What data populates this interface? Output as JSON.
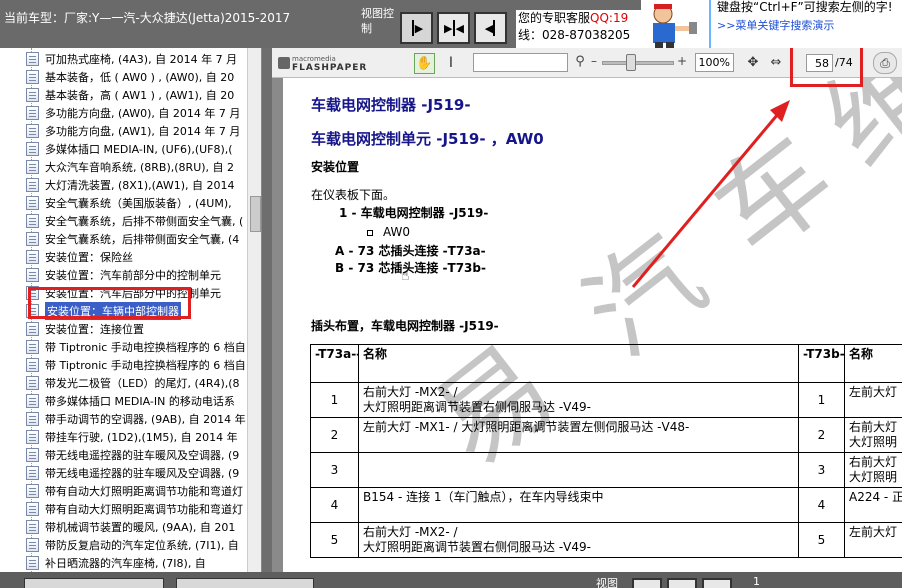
{
  "header": {
    "car_title": "当前车型：厂家:Y—一汽-大众捷达(Jetta)2015-2017",
    "view_control": "视图控制",
    "service_line1": "您的专职客服",
    "service_qq": "QQ:19",
    "service_line2": "线：028-87038205",
    "tip_text": "键盘按“Ctrl+F”可搜索左侧的字!",
    "tip_link": ">>菜单关键字搜索演示"
  },
  "tree": {
    "items": [
      {
        "label": "可加热式座椅, (4A3), 自 2014 年 7 月"
      },
      {
        "label": "基本装备，低 ( AW0 ) , (AW0), 自 20"
      },
      {
        "label": "基本装备，高 ( AW1 ) , (AW1), 自 20"
      },
      {
        "label": "多功能方向盘, (AW0), 自 2014 年 7 月"
      },
      {
        "label": "多功能方向盘, (AW1), 自 2014 年 7 月"
      },
      {
        "label": "多媒体插口 MEDIA-IN, (UF6),(UF8),("
      },
      {
        "label": "大众汽车音响系统, (8RB),(8RU), 自 2"
      },
      {
        "label": "大灯清洗装置, (8X1),(AW1), 自 2014"
      },
      {
        "label": "安全气囊系统（美国版装备）, (4UM), "
      },
      {
        "label": "安全气囊系统，后排不带侧面安全气囊, ("
      },
      {
        "label": "安全气囊系统，后排带侧面安全气囊, (4"
      },
      {
        "label": "安装位置：保险丝"
      },
      {
        "label": "安装位置：汽车前部分中的控制单元"
      },
      {
        "label": "安装位置：汽车后部分中的控制单元"
      },
      {
        "label": "安装位置：车辆中部控制器",
        "selected": true
      },
      {
        "label": "安装位置：连接位置"
      },
      {
        "label": "带 Tiptronic 手动电控换档程序的 6 档自"
      },
      {
        "label": "带 Tiptronic 手动电控换档程序的 6 档自"
      },
      {
        "label": "带发光二极管（LED）的尾灯, (4R4),(8"
      },
      {
        "label": "带多媒体插口 MEDIA-IN 的移动电话系"
      },
      {
        "label": "带手动调节的空调器, (9AB), 自 2014 年"
      },
      {
        "label": "带挂车行驶, (1D2),(1M5), 自 2014 年"
      },
      {
        "label": "带无线电遥控器的驻车暖风及空调器, (9"
      },
      {
        "label": "带无线电遥控器的驻车暖风及空调器, (9"
      },
      {
        "label": "带有自动大灯照明距离调节功能和弯道灯"
      },
      {
        "label": "带有自动大灯照明距离调节功能和弯道灯"
      },
      {
        "label": "带机械调节装置的暖风, (9AA), 自 201"
      },
      {
        "label": "带防反复启动的汽车定位系统, (7I1), 自"
      },
      {
        "label": "补日晒流器的汽车座椅, (7I8), 自"
      }
    ]
  },
  "toolbar": {
    "logo_top": "macromedia",
    "logo_bottom": "FLASHPAPER",
    "zoom": "100%",
    "page_current": "58",
    "page_total": "/74"
  },
  "document": {
    "title": "车载电网控制器 -J519-",
    "subtitle": "车载电网控制单元 -J519- ，AW0",
    "section_install": "安装位置",
    "install_line": "在仪表板下面。",
    "item1": "1 - 车载电网控制器 -J519-",
    "item1_sub": "AW0",
    "item_a": "A - 73 芯插头连接 -T73a-",
    "item_b": "B - 73 芯插头连接 -T73b-",
    "section_pins": "插头布置，车载电网控制器 -J519-",
    "table": {
      "headers": [
        "-T73a--A-",
        "名称",
        "-T73b--B-",
        "名称"
      ],
      "rows": [
        {
          "a": "1",
          "name_a": "右前大灯 -MX2- /\n大灯照明距离调节装置右侧伺服马达 -V49-",
          "b": "1",
          "name_b": "左前大灯"
        },
        {
          "a": "2",
          "name_a": "左前大灯 -MX1- / 大灯照明距离调节装置左侧伺服马达 -V48-",
          "b": "2",
          "name_b": "右前大灯\n大灯照明"
        },
        {
          "a": "3",
          "name_a": "",
          "b": "3",
          "name_b": "右前大灯\n大灯照明"
        },
        {
          "a": "4",
          "name_a": "B154 - 连接 1（车门触点），在车内导线束中",
          "b": "4",
          "name_b": "A224 - 正"
        },
        {
          "a": "5",
          "name_a": "右前大灯 -MX2- /\n大灯照明距离调节装置右侧伺服马达 -V49-",
          "b": "5",
          "name_b": "左前大灯"
        }
      ]
    }
  },
  "bottom": {
    "view_label": "视图",
    "page_num": "1"
  },
  "colors": {
    "heading_blue": "#16168a",
    "highlight_red": "#e02020",
    "selection_blue": "#3b5fc6",
    "chrome_gray": "#6a6a6a"
  }
}
